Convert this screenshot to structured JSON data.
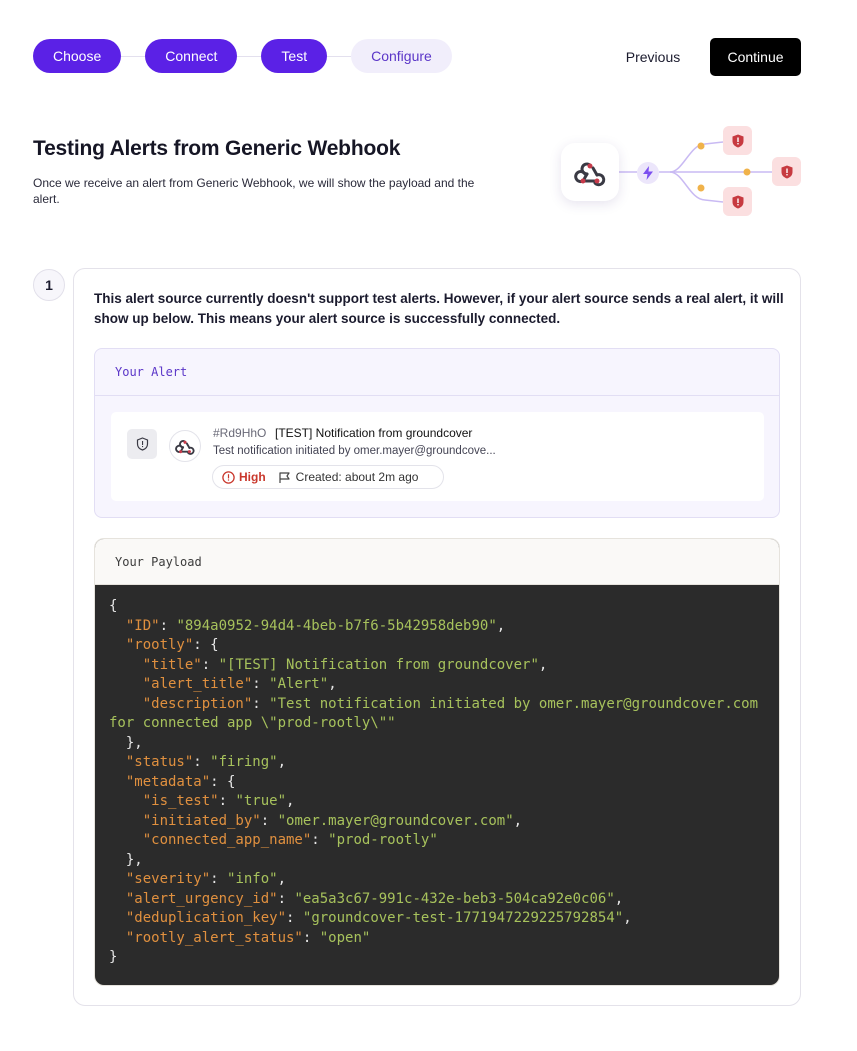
{
  "stepper": {
    "steps": [
      {
        "label": "Choose",
        "state": "done"
      },
      {
        "label": "Connect",
        "state": "done"
      },
      {
        "label": "Test",
        "state": "done"
      },
      {
        "label": "Configure",
        "state": "pending"
      }
    ],
    "previous_label": "Previous",
    "continue_label": "Continue"
  },
  "header": {
    "title": "Testing Alerts from Generic Webhook",
    "subtitle": "Once we receive an alert from Generic Webhook, we will show the payload and the alert."
  },
  "illustration": {
    "source_icon": "webhook-icon",
    "connector_icon": "bolt-icon",
    "target_icon": "shield-icon"
  },
  "step_card": {
    "number": "1",
    "intro": "This alert source currently doesn't support test alerts. However, if your alert source sends a real alert, it will show up below. This means your alert source is successfully connected.",
    "alert_section": {
      "header": "Your Alert",
      "alert": {
        "id": "#Rd9HhO",
        "title": "[TEST] Notification from groundcover",
        "description": "Test notification initiated by omer.mayer@groundcove...",
        "severity": "High",
        "created": "Created: about 2m ago"
      }
    },
    "payload_section": {
      "header": "Your Payload",
      "json": {
        "ID": "894a0952-94d4-4beb-b7f6-5b42958deb90",
        "rootly_title": "[TEST] Notification from groundcover",
        "rootly_alert_title": "Alert",
        "rootly_description": "Test notification initiated by omer.mayer@groundcover.com for connected app \\\"prod-rootly\\\"",
        "status": "firing",
        "metadata_is_test": "true",
        "metadata_initiated_by": "omer.mayer@groundcover.com",
        "metadata_connected_app_name": "prod-rootly",
        "severity": "info",
        "alert_urgency_id": "ea5a3c67-991c-432e-beb3-504ca92e0c06",
        "deduplication_key": "groundcover-test-1771947229225792854",
        "rootly_alert_status": "open"
      }
    }
  },
  "colors": {
    "accent": "#5b21e6",
    "severity_high": "#c9372c",
    "code_bg": "#2b2b2b",
    "code_key": "#e0903f",
    "code_string": "#a7c25c"
  }
}
